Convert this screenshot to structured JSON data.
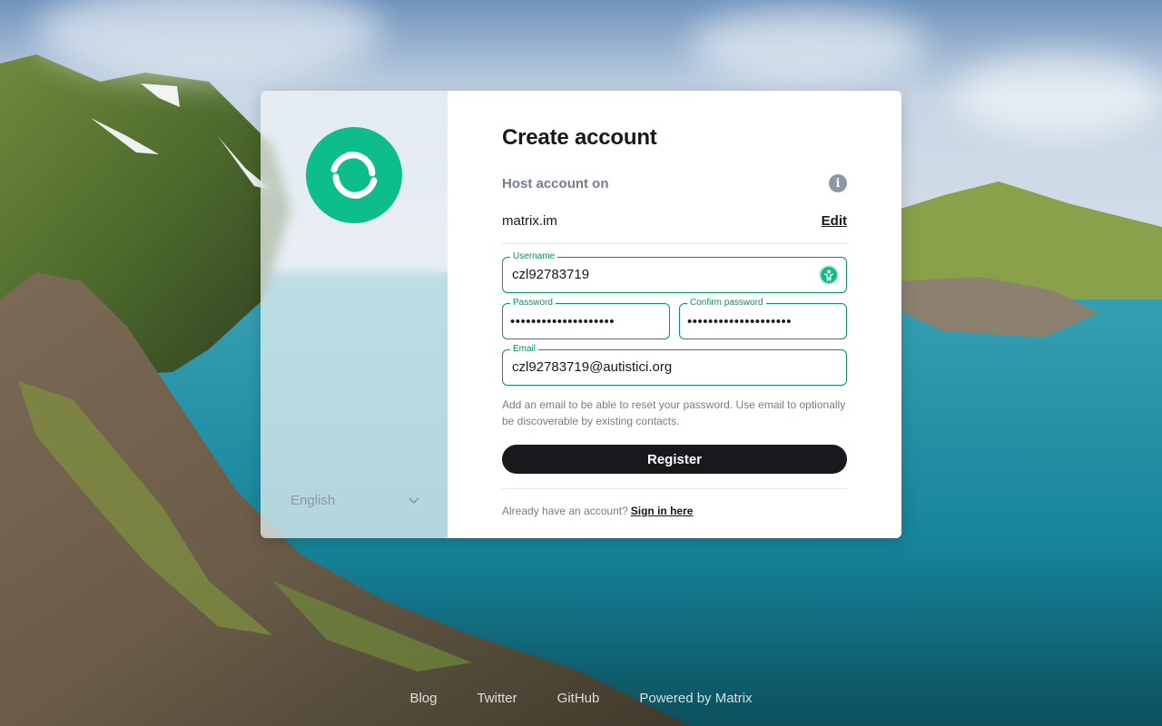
{
  "card": {
    "title": "Create account",
    "host_label": "Host account on",
    "server_name": "matrix.im",
    "edit_label": "Edit",
    "username": {
      "label": "Username",
      "value": "czl92783719"
    },
    "password": {
      "label": "Password",
      "value": "••••••••••••••••••••"
    },
    "confirm_password": {
      "label": "Confirm password",
      "value": "••••••••••••••••••••"
    },
    "email": {
      "label": "Email",
      "value": "czl92783719@autistici.org"
    },
    "email_hint": "Add an email to be able to reset your password. Use email to optionally be discoverable by existing contacts.",
    "register_label": "Register",
    "signin_prompt": "Already have an account?",
    "signin_link": "Sign in here"
  },
  "language": {
    "selected": "English"
  },
  "footer": {
    "links": [
      "Blog",
      "Twitter",
      "GitHub",
      "Powered by Matrix"
    ]
  },
  "colors": {
    "accent": "#0dbd8b",
    "field_border": "#0a8f66",
    "button": "#17191c"
  },
  "icons": {
    "logo": "element-logo-icon",
    "info": "info-icon",
    "user_badge": "user-avatar-icon",
    "dropdown": "chevron-down-icon"
  }
}
